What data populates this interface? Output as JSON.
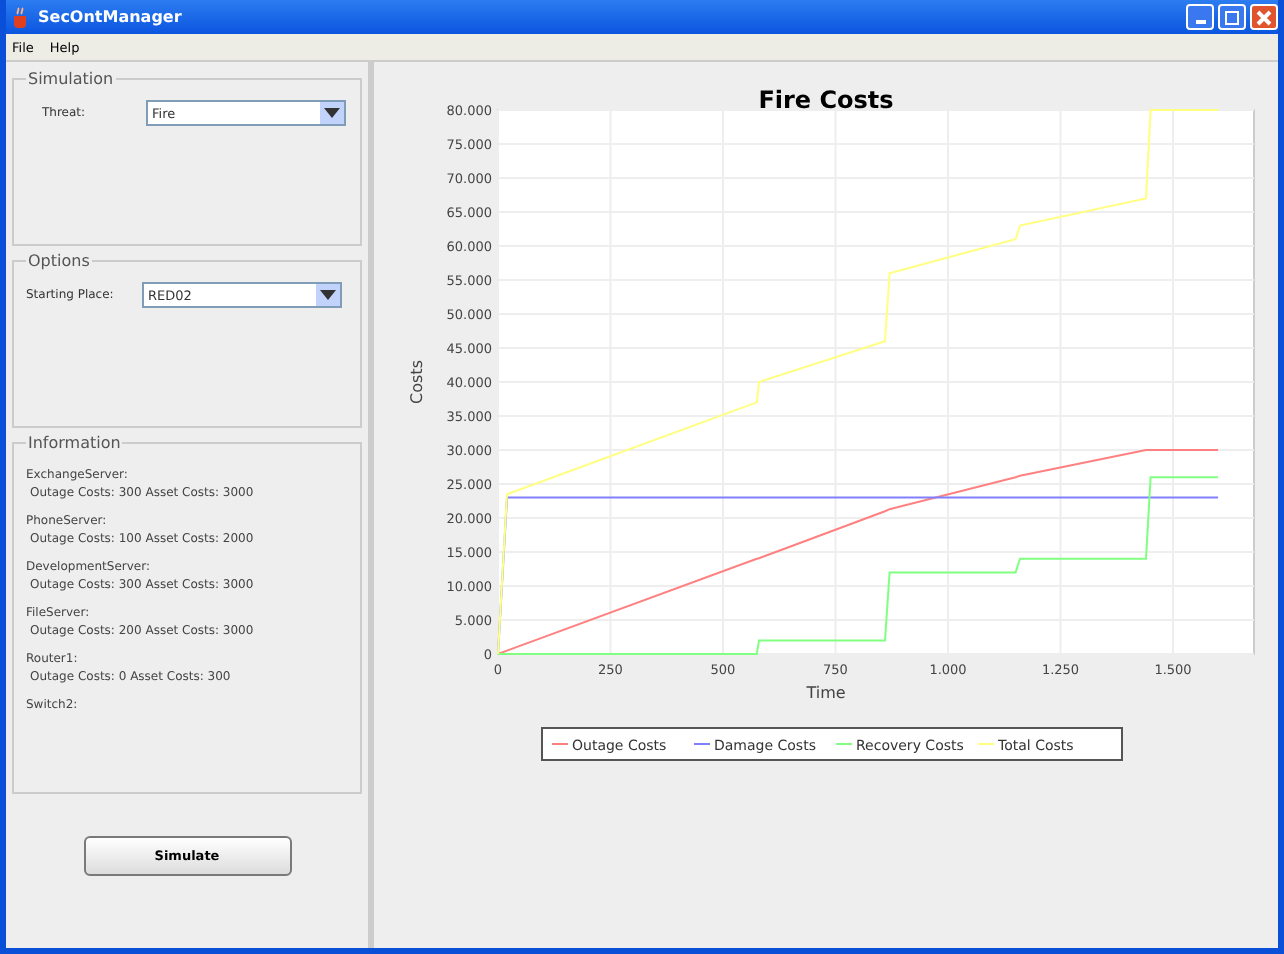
{
  "window": {
    "title": "SecOntManager"
  },
  "menu": [
    "File",
    "Help"
  ],
  "simulation": {
    "title": "Simulation",
    "threat_label": "Threat:",
    "threat_value": "Fire"
  },
  "options": {
    "title": "Options",
    "starting_label": "Starting Place:",
    "starting_value": "RED02"
  },
  "information": {
    "title": "Information",
    "entries": [
      {
        "name": "ExchangeServer:",
        "detail": "Outage Costs: 300 Asset Costs: 3000"
      },
      {
        "name": "PhoneServer:",
        "detail": "Outage Costs: 100 Asset Costs: 2000"
      },
      {
        "name": "DevelopmentServer:",
        "detail": "Outage Costs: 300 Asset Costs: 3000"
      },
      {
        "name": "FileServer:",
        "detail": "Outage Costs: 200 Asset Costs: 3000"
      },
      {
        "name": "Router1:",
        "detail": "Outage Costs: 0 Asset Costs: 300"
      },
      {
        "name": "Switch2:"
      }
    ]
  },
  "simulate_button": "Simulate",
  "chart": {
    "chart_data": {
      "type": "line",
      "title": "Fire Costs",
      "xlabel": "Time",
      "ylabel": "Costs",
      "x": [
        0,
        20,
        575,
        580,
        860,
        870,
        1150,
        1160,
        1440,
        1450,
        1600
      ],
      "series": [
        {
          "name": "Outage Costs",
          "color": "#ff8080",
          "values": [
            0,
            500,
            14000,
            14100,
            21000,
            21300,
            26000,
            26200,
            30000,
            30000,
            30000
          ]
        },
        {
          "name": "Damage Costs",
          "color": "#8080ff",
          "values": [
            0,
            23000,
            23000,
            23000,
            23000,
            23000,
            23000,
            23000,
            23000,
            23000,
            23000
          ]
        },
        {
          "name": "Recovery Costs",
          "color": "#80ff80",
          "values": [
            0,
            0,
            0,
            2000,
            2000,
            12000,
            12000,
            14000,
            14000,
            26000,
            26000
          ]
        },
        {
          "name": "Total Costs",
          "color": "#ffff80",
          "values": [
            0,
            23500,
            37000,
            40000,
            46000,
            56000,
            61000,
            63000,
            67000,
            80000,
            80000
          ]
        }
      ],
      "xlim": [
        0,
        1680
      ],
      "ylim": [
        0,
        80000
      ],
      "grid": true,
      "legend": true,
      "xticks": [
        0,
        250,
        500,
        750,
        {
          "value": 1000,
          "label": "1.000"
        },
        {
          "value": 1250,
          "label": "1.250"
        },
        {
          "value": 1500,
          "label": "1.500"
        }
      ],
      "yticks": [
        0,
        {
          "value": 5000,
          "label": "5.000"
        },
        {
          "value": 10000,
          "label": "10.000"
        },
        {
          "value": 15000,
          "label": "15.000"
        },
        {
          "value": 20000,
          "label": "20.000"
        },
        {
          "value": 25000,
          "label": "25.000"
        },
        {
          "value": 30000,
          "label": "30.000"
        },
        {
          "value": 35000,
          "label": "35.000"
        },
        {
          "value": 40000,
          "label": "40.000"
        },
        {
          "value": 45000,
          "label": "45.000"
        },
        {
          "value": 50000,
          "label": "50.000"
        },
        {
          "value": 55000,
          "label": "55.000"
        },
        {
          "value": 60000,
          "label": "60.000"
        },
        {
          "value": 65000,
          "label": "65.000"
        },
        {
          "value": 70000,
          "label": "70.000"
        },
        {
          "value": 75000,
          "label": "75.000"
        },
        {
          "value": 80000,
          "label": "80.000"
        }
      ]
    }
  }
}
